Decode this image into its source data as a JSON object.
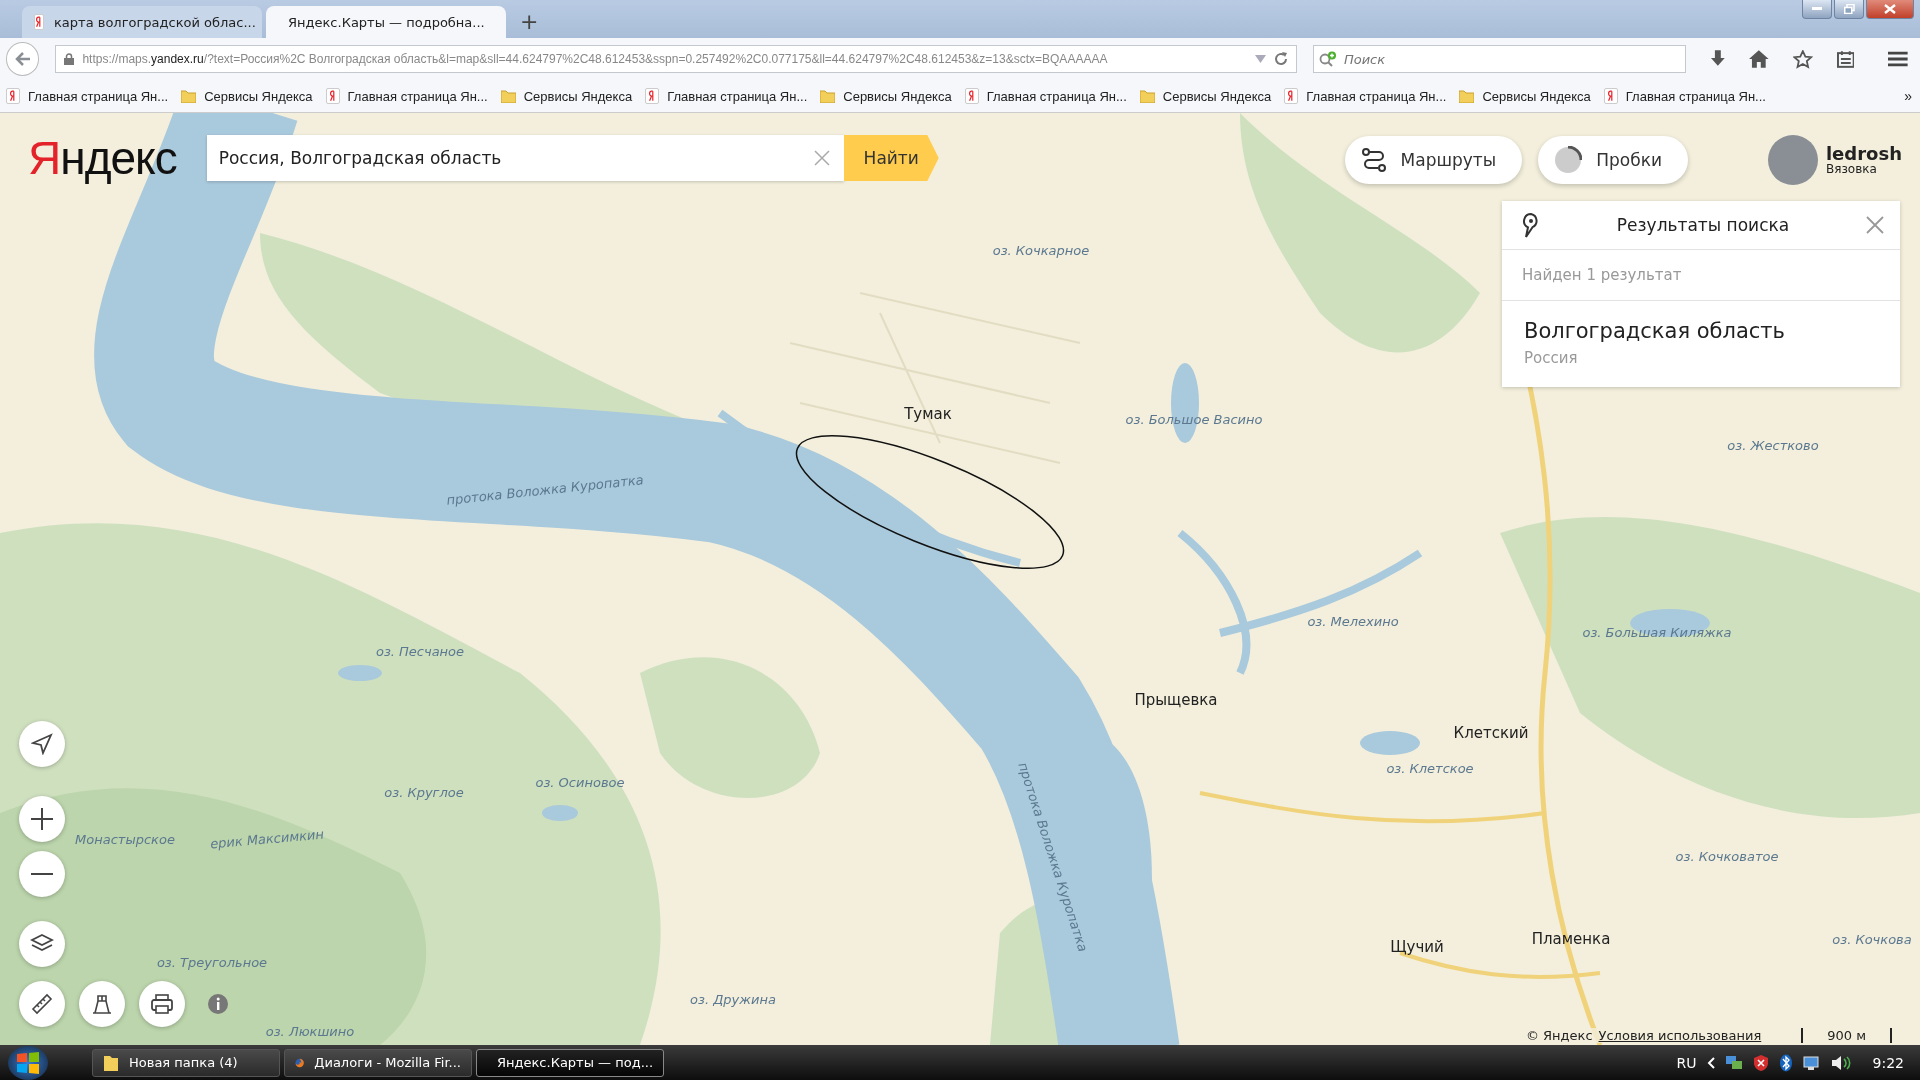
{
  "browser": {
    "tabs": [
      {
        "title": "карта волгоградской облас...",
        "kind": "yandex",
        "selected": false
      },
      {
        "title": "Яндекс.Карты — подробна...",
        "kind": "maps",
        "selected": true
      }
    ],
    "new_tab": "+",
    "url": {
      "prefix": "https://maps.",
      "domain": "yandex.ru",
      "path": "/?text=Россия%2C Волгоградская область&l=map&sll=44.624797%2C48.612453&sspn=0.257492%2C0.077175&ll=44.624797%2C48.612453&z=13&sctx=BQAAAAAA"
    },
    "search": {
      "placeholder": "Поиск"
    },
    "bookmarks": [
      {
        "label": "Главная страница Ян...",
        "kind": "yandex"
      },
      {
        "label": "Сервисы Яндекса",
        "kind": "folder"
      },
      {
        "label": "Главная страница Ян...",
        "kind": "yandex"
      },
      {
        "label": "Сервисы Яндекса",
        "kind": "folder"
      },
      {
        "label": "Главная страница Ян...",
        "kind": "yandex"
      },
      {
        "label": "Сервисы Яндекса",
        "kind": "folder"
      },
      {
        "label": "Главная страница Ян...",
        "kind": "yandex"
      },
      {
        "label": "Сервисы Яндекса",
        "kind": "folder"
      },
      {
        "label": "Главная страница Ян...",
        "kind": "yandex"
      },
      {
        "label": "Сервисы Яндекса",
        "kind": "folder"
      },
      {
        "label": "Главная страница Ян...",
        "kind": "yandex"
      }
    ],
    "more": "»"
  },
  "map": {
    "logo": "Яндекс",
    "search": {
      "value": "Россия, Волгоградская область"
    },
    "search_button": "Найти",
    "buttons": [
      {
        "label": "Маршруты",
        "kind": "routes"
      },
      {
        "label": "Пробки",
        "kind": "traffic"
      }
    ],
    "user": {
      "name": "ledrosh",
      "place": "Вязовка"
    },
    "results": {
      "title": "Результаты поиска",
      "count": "Найден 1 результат",
      "items": [
        {
          "name": "Волгоградская область",
          "subtitle": "Россия"
        }
      ]
    },
    "labels": [
      {
        "text": "оз. Кочкарное",
        "kind": "lake"
      },
      {
        "text": "Тумак",
        "kind": "town"
      },
      {
        "text": "оз. Большое Васино",
        "kind": "lake"
      },
      {
        "text": "оз. Жестково",
        "kind": "lake"
      },
      {
        "text": "протока Воложка Куропатка",
        "kind": "river"
      },
      {
        "text": "оз. Мелехино",
        "kind": "lake"
      },
      {
        "text": "оз. Большая Киляжка",
        "kind": "lake"
      },
      {
        "text": "оз. Песчаное",
        "kind": "lake"
      },
      {
        "text": "Прыщевка",
        "kind": "town"
      },
      {
        "text": "Клетский",
        "kind": "town"
      },
      {
        "text": "оз. Клетское",
        "kind": "lake"
      },
      {
        "text": "оз. Осиновое",
        "kind": "lake"
      },
      {
        "text": "оз. Круглое",
        "kind": "lake"
      },
      {
        "text": "Монастырское",
        "kind": "lake"
      },
      {
        "text": "ерик Максимкин",
        "kind": "river"
      },
      {
        "text": "оз. Кочковатое",
        "kind": "lake"
      },
      {
        "text": "протока Воложка Куропатка",
        "kind": "river"
      },
      {
        "text": "Щучий",
        "kind": "town"
      },
      {
        "text": "Пламенка",
        "kind": "town"
      },
      {
        "text": "оз. Кочкова",
        "kind": "lake"
      },
      {
        "text": "оз. Треугольное",
        "kind": "lake"
      },
      {
        "text": "оз. Дружина",
        "kind": "lake"
      },
      {
        "text": "оз. Люкшино",
        "kind": "lake"
      }
    ],
    "copyright": "© Яндекс",
    "terms": "Условия использования",
    "scale": "900 м"
  },
  "taskbar": {
    "items": [
      {
        "label": "Новая папка (4)",
        "kind": "folder",
        "selected": false
      },
      {
        "label": "Диалоги - Mozilla Fir...",
        "kind": "firefox",
        "selected": false
      },
      {
        "label": "Яндекс.Карты — под...",
        "kind": "firefox",
        "selected": true
      }
    ],
    "language": "RU",
    "time": "9:22"
  }
}
